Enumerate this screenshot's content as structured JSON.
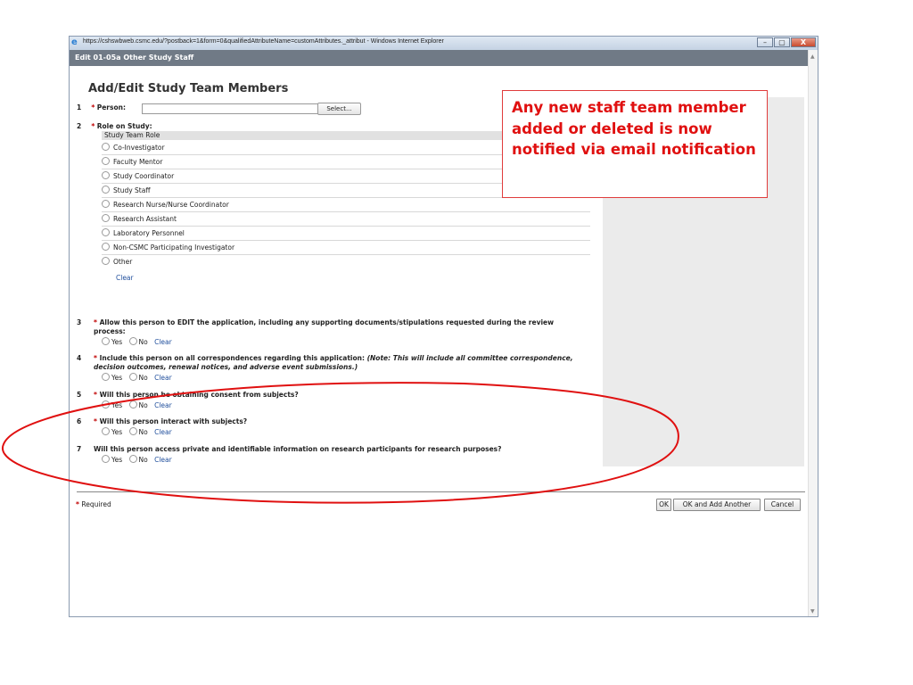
{
  "window": {
    "url_title": "https://cshswbweb.csmc.edu/?postback=1&form=0&qualifiedAttributeName=customAttributes._attribut - Windows Internet Explorer",
    "controls": [
      "–",
      "▢",
      "X"
    ]
  },
  "header": {
    "title": "Edit 01-05a Other Study Staff"
  },
  "form": {
    "title": "Add/Edit Study Team Members",
    "q1": {
      "num": "1",
      "label": "Person:",
      "value": "",
      "select_label": "Select..."
    },
    "q2": {
      "num": "2",
      "label": "Role on Study:",
      "header": "Study Team Role",
      "roles": [
        "Co-Investigator",
        "Faculty Mentor",
        "Study Coordinator",
        "Study Staff",
        "Research Nurse/Nurse Coordinator",
        "Research Assistant",
        "Laboratory Personnel",
        "Non-CSMC Participating Investigator",
        "Other"
      ],
      "clear": "Clear"
    },
    "q3": {
      "num": "3",
      "text": "Allow this person to EDIT the application, including any supporting documents/stipulations requested during the review process:"
    },
    "q4": {
      "num": "4",
      "text_a": "Include this person on all correspondences regarding this application: ",
      "text_b": "(Note: This will include all committee correspondence, decision outcomes, renewal notices, and adverse event submissions.)"
    },
    "q5": {
      "num": "5",
      "text": "Will this person be obtaining consent from subjects?"
    },
    "q6": {
      "num": "6",
      "text": "Will this person interact with subjects?"
    },
    "q7": {
      "num": "7",
      "text": "Will this person access private and identifiable information on research participants for research purposes?"
    },
    "yes": "Yes",
    "no": "No",
    "clear": "Clear",
    "asterisk": "*"
  },
  "footer": {
    "required": "Required",
    "ok": "OK",
    "ok_add": "OK and Add Another",
    "cancel": "Cancel"
  },
  "callout": {
    "text": "Any new staff team member added or deleted is now notified via email notification",
    "color": "#e01010"
  }
}
